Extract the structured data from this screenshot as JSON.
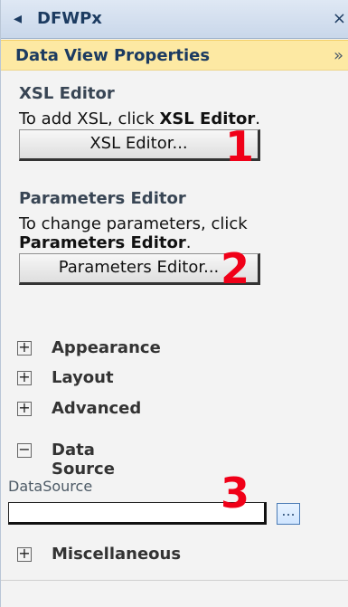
{
  "window": {
    "title": "DFWPx",
    "close_glyph": "×",
    "back_glyph": "◂"
  },
  "panel": {
    "title": "Data View Properties",
    "collapse_glyph": "»",
    "xsl": {
      "heading": "XSL Editor",
      "text_prefix": "To add XSL, click ",
      "text_bold": "XSL Editor",
      "text_suffix": ".",
      "button": "XSL Editor...",
      "badge": "1"
    },
    "params": {
      "heading": "Parameters Editor",
      "text_line1": "To change parameters, click",
      "text_bold": "Parameters Editor",
      "text_suffix": ".",
      "button": "Parameters Editor...",
      "badge": "2"
    },
    "groups": [
      {
        "label": "Appearance",
        "expanded": false
      },
      {
        "label": "Layout",
        "expanded": false
      },
      {
        "label": "Advanced",
        "expanded": false
      },
      {
        "label": "Data Source",
        "expanded": true
      },
      {
        "label": "Miscellaneous",
        "expanded": false
      }
    ],
    "datasource": {
      "label": "DataSource",
      "value": "",
      "button": "...",
      "badge": "3"
    }
  },
  "icons": {
    "plus": "+",
    "minus": "−"
  }
}
